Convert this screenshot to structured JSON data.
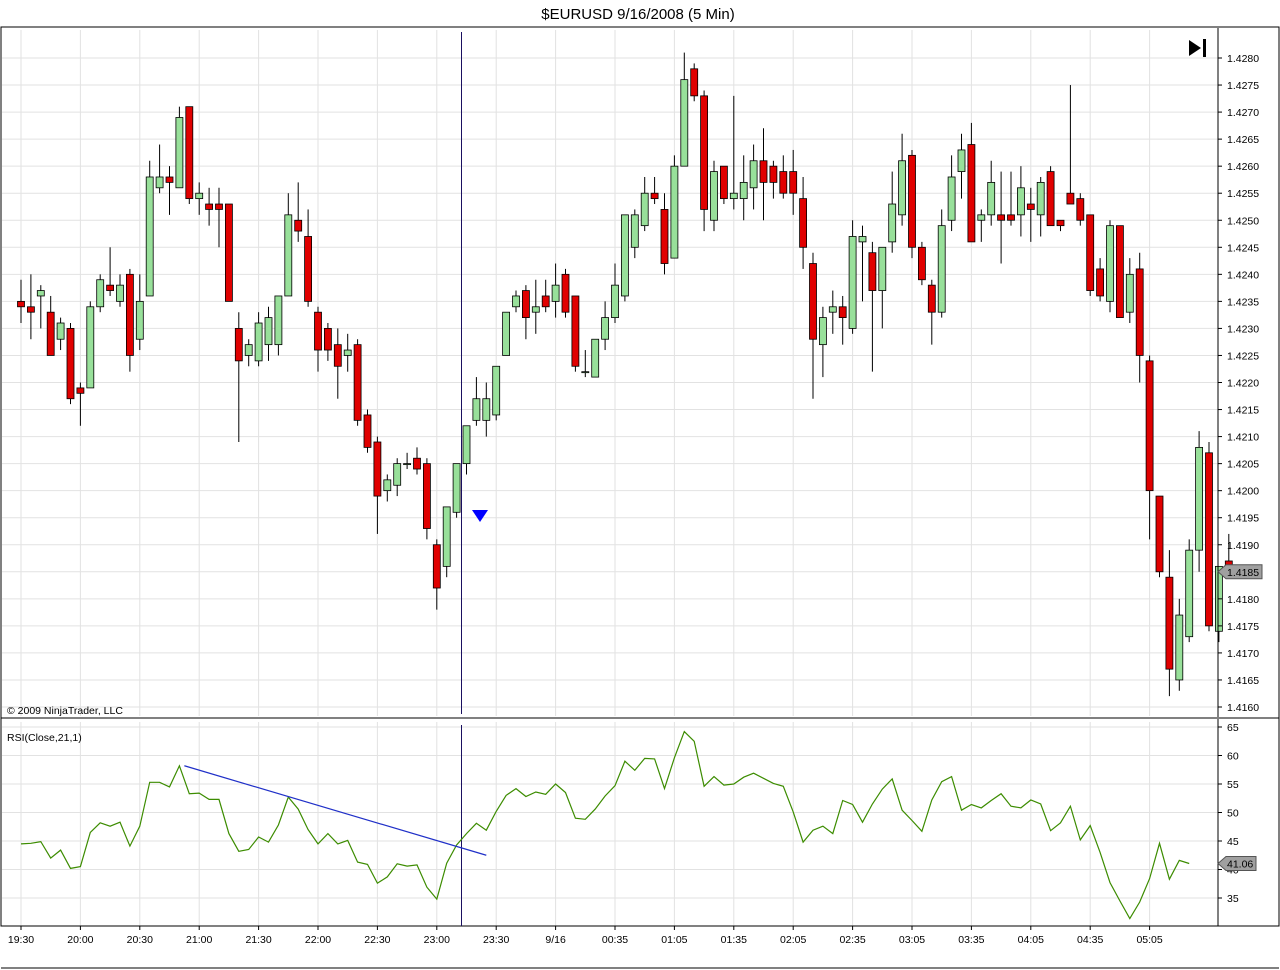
{
  "title": "$EURUSD  9/16/2008 (5 Min)",
  "copyright": "© 2009 NinjaTrader, LLC",
  "indicator_label": "RSI(Close,21,1)",
  "colors": {
    "up_fill": "#98e09a",
    "down_fill": "#e00000",
    "candle_outline": "#000000",
    "rsi_line": "#3c8c00",
    "trendline": "#2030c8",
    "cursor_line": "#1a1060",
    "arrow": "#0000ff",
    "grid": "#e2e2e2"
  },
  "icons": {
    "scroll_end": "skip-to-end-icon"
  },
  "chart_data": [
    {
      "type": "candlestick",
      "title": "$EURUSD  9/16/2008 (5 Min)",
      "y_ticks": [
        "1.4280",
        "1.4275",
        "1.4270",
        "1.4265",
        "1.4260",
        "1.4255",
        "1.4250",
        "1.4245",
        "1.4240",
        "1.4235",
        "1.4230",
        "1.4225",
        "1.4220",
        "1.4215",
        "1.4210",
        "1.4205",
        "1.4200",
        "1.4195",
        "1.4190",
        "1.4185",
        "1.4180",
        "1.4175",
        "1.4170",
        "1.4165",
        "1.4160"
      ],
      "ylim": [
        1.4158,
        1.4284
      ],
      "last_price_label": "1.4185",
      "last_price": 1.4185,
      "candles": [
        [
          1.4235,
          1.4239,
          1.4231,
          1.4234
        ],
        [
          1.4234,
          1.424,
          1.4228,
          1.4233
        ],
        [
          1.4236,
          1.4238,
          1.423,
          1.4237
        ],
        [
          1.4233,
          1.4236,
          1.4225,
          1.4225
        ],
        [
          1.4228,
          1.4232,
          1.4226,
          1.4231
        ],
        [
          1.423,
          1.4231,
          1.4216,
          1.4217
        ],
        [
          1.4219,
          1.422,
          1.4212,
          1.4218
        ],
        [
          1.4219,
          1.4235,
          1.4219,
          1.4234
        ],
        [
          1.4234,
          1.424,
          1.4233,
          1.4239
        ],
        [
          1.4238,
          1.4245,
          1.4236,
          1.4237
        ],
        [
          1.4235,
          1.424,
          1.4234,
          1.4238
        ],
        [
          1.424,
          1.4241,
          1.4222,
          1.4225
        ],
        [
          1.4228,
          1.424,
          1.4226,
          1.4235
        ],
        [
          1.4236,
          1.4261,
          1.4236,
          1.4258
        ],
        [
          1.4256,
          1.4264,
          1.4255,
          1.4258
        ],
        [
          1.4258,
          1.426,
          1.4251,
          1.4257
        ],
        [
          1.4256,
          1.4271,
          1.4256,
          1.4269
        ],
        [
          1.4271,
          1.4271,
          1.4253,
          1.4254
        ],
        [
          1.4254,
          1.4257,
          1.4251,
          1.4255
        ],
        [
          1.4253,
          1.4256,
          1.4249,
          1.4252
        ],
        [
          1.4253,
          1.4256,
          1.4245,
          1.4252
        ],
        [
          1.4253,
          1.4253,
          1.4235,
          1.4235
        ],
        [
          1.423,
          1.4233,
          1.4209,
          1.4224
        ],
        [
          1.4225,
          1.4228,
          1.4223,
          1.4227
        ],
        [
          1.4224,
          1.4233,
          1.4223,
          1.4231
        ],
        [
          1.4227,
          1.4234,
          1.4224,
          1.4232
        ],
        [
          1.4227,
          1.4236,
          1.4225,
          1.4236
        ],
        [
          1.4236,
          1.4255,
          1.4236,
          1.4251
        ],
        [
          1.425,
          1.4257,
          1.4246,
          1.4248
        ],
        [
          1.4247,
          1.4252,
          1.4234,
          1.4235
        ],
        [
          1.4233,
          1.4234,
          1.4222,
          1.4226
        ],
        [
          1.423,
          1.4231,
          1.4224,
          1.4226
        ],
        [
          1.4227,
          1.423,
          1.4217,
          1.4223
        ],
        [
          1.4225,
          1.4229,
          1.4222,
          1.4226
        ],
        [
          1.4227,
          1.4228,
          1.4212,
          1.4213
        ],
        [
          1.4214,
          1.4215,
          1.4207,
          1.4208
        ],
        [
          1.4209,
          1.421,
          1.4192,
          1.4199
        ],
        [
          1.42,
          1.4203,
          1.4198,
          1.4202
        ],
        [
          1.4201,
          1.4206,
          1.4199,
          1.4205
        ],
        [
          1.4205,
          1.4207,
          1.4204,
          1.4205
        ],
        [
          1.4206,
          1.4208,
          1.4203,
          1.4204
        ],
        [
          1.4205,
          1.4206,
          1.4191,
          1.4193
        ],
        [
          1.419,
          1.4191,
          1.4178,
          1.4182
        ],
        [
          1.4186,
          1.4197,
          1.4184,
          1.4197
        ],
        [
          1.4196,
          1.4205,
          1.4195,
          1.4205
        ],
        [
          1.4205,
          1.4212,
          1.4203,
          1.4212
        ],
        [
          1.4213,
          1.4221,
          1.4212,
          1.4217
        ],
        [
          1.4213,
          1.422,
          1.421,
          1.4217
        ],
        [
          1.4214,
          1.4223,
          1.4213,
          1.4223
        ],
        [
          1.4225,
          1.4233,
          1.4225,
          1.4233
        ],
        [
          1.4234,
          1.4237,
          1.4233,
          1.4236
        ],
        [
          1.4237,
          1.4238,
          1.4228,
          1.4232
        ],
        [
          1.4233,
          1.4239,
          1.4229,
          1.4234
        ],
        [
          1.4236,
          1.4239,
          1.4233,
          1.4234
        ],
        [
          1.4235,
          1.4242,
          1.4232,
          1.4238
        ],
        [
          1.424,
          1.4241,
          1.4232,
          1.4233
        ],
        [
          1.4236,
          1.4236,
          1.4222,
          1.4223
        ],
        [
          1.4222,
          1.4226,
          1.4221,
          1.4222
        ],
        [
          1.4221,
          1.4225,
          1.4221,
          1.4228
        ],
        [
          1.4228,
          1.4235,
          1.4226,
          1.4232
        ],
        [
          1.4232,
          1.4242,
          1.4231,
          1.4238
        ],
        [
          1.4236,
          1.4246,
          1.4235,
          1.4251
        ],
        [
          1.4245,
          1.4252,
          1.4243,
          1.4251
        ],
        [
          1.4249,
          1.4258,
          1.4248,
          1.4255
        ],
        [
          1.4255,
          1.4258,
          1.4253,
          1.4254
        ],
        [
          1.4252,
          1.4255,
          1.424,
          1.4242
        ],
        [
          1.4243,
          1.4262,
          1.4243,
          1.426
        ],
        [
          1.426,
          1.4281,
          1.426,
          1.4276
        ],
        [
          1.4278,
          1.4279,
          1.4272,
          1.4273
        ],
        [
          1.4273,
          1.4274,
          1.4248,
          1.4252
        ],
        [
          1.425,
          1.4261,
          1.4248,
          1.4259
        ],
        [
          1.426,
          1.426,
          1.4253,
          1.4254
        ],
        [
          1.4254,
          1.4273,
          1.4252,
          1.4255
        ],
        [
          1.4254,
          1.4262,
          1.425,
          1.4257
        ],
        [
          1.4256,
          1.4264,
          1.4252,
          1.4261
        ],
        [
          1.4261,
          1.4267,
          1.425,
          1.4257
        ],
        [
          1.426,
          1.4261,
          1.4254,
          1.4257
        ],
        [
          1.4259,
          1.4262,
          1.4254,
          1.4255
        ],
        [
          1.4259,
          1.4263,
          1.4251,
          1.4255
        ],
        [
          1.4254,
          1.4258,
          1.4241,
          1.4245
        ],
        [
          1.4242,
          1.4244,
          1.4217,
          1.4228
        ],
        [
          1.4227,
          1.4234,
          1.4221,
          1.4232
        ],
        [
          1.4233,
          1.4237,
          1.4229,
          1.4234
        ],
        [
          1.4234,
          1.4236,
          1.4227,
          1.4232
        ],
        [
          1.423,
          1.425,
          1.4229,
          1.4247
        ],
        [
          1.4246,
          1.4249,
          1.4235,
          1.4247
        ],
        [
          1.4244,
          1.4246,
          1.4222,
          1.4237
        ],
        [
          1.4237,
          1.4245,
          1.423,
          1.4245
        ],
        [
          1.4246,
          1.4259,
          1.4244,
          1.4253
        ],
        [
          1.4251,
          1.4266,
          1.4249,
          1.4261
        ],
        [
          1.4262,
          1.4263,
          1.4243,
          1.4245
        ],
        [
          1.4245,
          1.4246,
          1.4238,
          1.4239
        ],
        [
          1.4238,
          1.4239,
          1.4227,
          1.4233
        ],
        [
          1.4233,
          1.4252,
          1.4232,
          1.4249
        ],
        [
          1.425,
          1.4262,
          1.4248,
          1.4258
        ],
        [
          1.4259,
          1.4266,
          1.4254,
          1.4263
        ],
        [
          1.4264,
          1.4268,
          1.4246,
          1.4246
        ],
        [
          1.425,
          1.4252,
          1.4246,
          1.4251
        ],
        [
          1.4251,
          1.4261,
          1.4249,
          1.4257
        ],
        [
          1.4251,
          1.4259,
          1.4242,
          1.425
        ],
        [
          1.4251,
          1.4259,
          1.4249,
          1.425
        ],
        [
          1.4251,
          1.426,
          1.4247,
          1.4256
        ],
        [
          1.4253,
          1.4256,
          1.4246,
          1.4252
        ],
        [
          1.4251,
          1.4258,
          1.4247,
          1.4257
        ],
        [
          1.4259,
          1.426,
          1.4253,
          1.4249
        ],
        [
          1.425,
          1.425,
          1.4248,
          1.4249
        ],
        [
          1.4255,
          1.4275,
          1.4254,
          1.4253
        ],
        [
          1.4254,
          1.4255,
          1.4249,
          1.425
        ],
        [
          1.4251,
          1.4251,
          1.4236,
          1.4237
        ],
        [
          1.4241,
          1.4243,
          1.4235,
          1.4236
        ],
        [
          1.4235,
          1.425,
          1.4233,
          1.4249
        ],
        [
          1.4249,
          1.4249,
          1.4232,
          1.4232
        ],
        [
          1.4233,
          1.4243,
          1.4231,
          1.424
        ],
        [
          1.4241,
          1.4244,
          1.422,
          1.4225
        ],
        [
          1.4224,
          1.4225,
          1.4191,
          1.42
        ],
        [
          1.4199,
          1.4199,
          1.4184,
          1.4185
        ],
        [
          1.4184,
          1.4189,
          1.4162,
          1.4167
        ],
        [
          1.4165,
          1.418,
          1.4163,
          1.4177
        ],
        [
          1.4173,
          1.4191,
          1.4172,
          1.4189
        ],
        [
          1.4189,
          1.4211,
          1.4185,
          1.4208
        ],
        [
          1.4207,
          1.4209,
          1.4174,
          1.4175
        ],
        [
          1.4174,
          1.4186,
          1.4172,
          1.4186
        ],
        [
          1.4187,
          1.4192,
          1.4185,
          1.4185
        ]
      ]
    },
    {
      "type": "line",
      "title": "RSI(Close,21,1)",
      "y_ticks": [
        "65",
        "60",
        "55",
        "50",
        "45",
        "40",
        "35"
      ],
      "ylim": [
        30,
        65
      ],
      "last_value_label": "41.06",
      "values": [
        44.5,
        44.6,
        44.9,
        42.0,
        43.4,
        40.2,
        40.5,
        46.5,
        48.2,
        47.6,
        48.3,
        44.1,
        47.6,
        55.3,
        55.3,
        54.5,
        58.2,
        53.3,
        53.4,
        52.3,
        52.3,
        46.3,
        43.2,
        43.5,
        45.7,
        44.8,
        47.8,
        52.7,
        50.6,
        47.0,
        44.5,
        46.3,
        44.5,
        45.1,
        41.3,
        40.9,
        37.6,
        38.7,
        41.0,
        40.6,
        40.8,
        36.9,
        34.8,
        41.1,
        44.3,
        46.3,
        48.1,
        46.9,
        50.2,
        53.0,
        54.2,
        52.8,
        53.6,
        53.2,
        55.0,
        53.5,
        49.0,
        48.8,
        50.6,
        52.9,
        54.7,
        59.0,
        57.4,
        59.5,
        59.4,
        54.2,
        59.6,
        64.2,
        62.5,
        54.6,
        56.3,
        54.8,
        55.0,
        56.2,
        56.9,
        56.0,
        55.1,
        54.6,
        50.1,
        44.8,
        46.9,
        47.6,
        46.3,
        52.1,
        51.4,
        48.3,
        51.5,
        54.1,
        55.9,
        50.4,
        48.6,
        46.7,
        52.2,
        55.4,
        56.3,
        50.4,
        51.4,
        50.8,
        52.1,
        53.3,
        51.1,
        50.8,
        52.2,
        51.5,
        46.8,
        48.2,
        51.1,
        45.2,
        47.7,
        43.0,
        37.7,
        34.5,
        31.4,
        34.3,
        38.4,
        44.6,
        38.3,
        41.6,
        41.06
      ],
      "trendline": {
        "x_index": [
          16.5,
          47
        ],
        "y_values": [
          58.2,
          42.5
        ]
      }
    }
  ],
  "x_axis": {
    "labels": [
      "19:30",
      "20:00",
      "20:30",
      "21:00",
      "21:30",
      "22:00",
      "22:30",
      "23:00",
      "23:30",
      "9/16",
      "00:35",
      "01:05",
      "01:35",
      "02:05",
      "02:35",
      "03:05",
      "03:35",
      "04:05",
      "04:35",
      "05:05"
    ]
  }
}
